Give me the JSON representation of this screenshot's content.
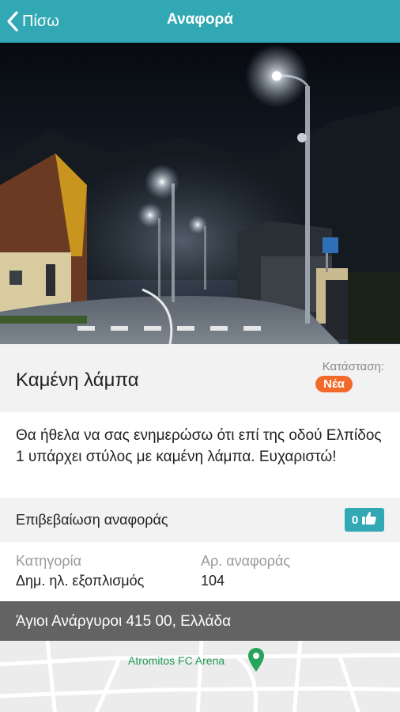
{
  "header": {
    "back_label": "Πίσω",
    "title": "Αναφορά"
  },
  "report": {
    "title": "Καμένη λάμπα",
    "status_label": "Κατάσταση:",
    "status_value": "Νέα",
    "description": "Θα ήθελα να σας ενημερώσω ότι επί της οδού Ελπίδος 1 υπάρχει στύλος με καμένη λάμπα. Ευχαριστώ!"
  },
  "confirm": {
    "label": "Επιβεβαίωση αναφοράς",
    "count": "0"
  },
  "details": {
    "category_label": "Κατηγορία",
    "category_value": "Δημ. ηλ. εξοπλισμός",
    "number_label": "Αρ. αναφοράς",
    "number_value": "104"
  },
  "location": {
    "address": "Άγιοι Ανάργυροι 415 00, Ελλάδα",
    "map_label": "Atromitos FC Arena"
  },
  "colors": {
    "accent": "#31a8b3",
    "status_badge": "#f26a2a",
    "address_bar": "#636363",
    "map_place": "#1f9a55"
  },
  "icons": {
    "back": "chevron-left-icon",
    "like": "thumbs-up-icon",
    "map_pin": "map-pin-icon"
  }
}
